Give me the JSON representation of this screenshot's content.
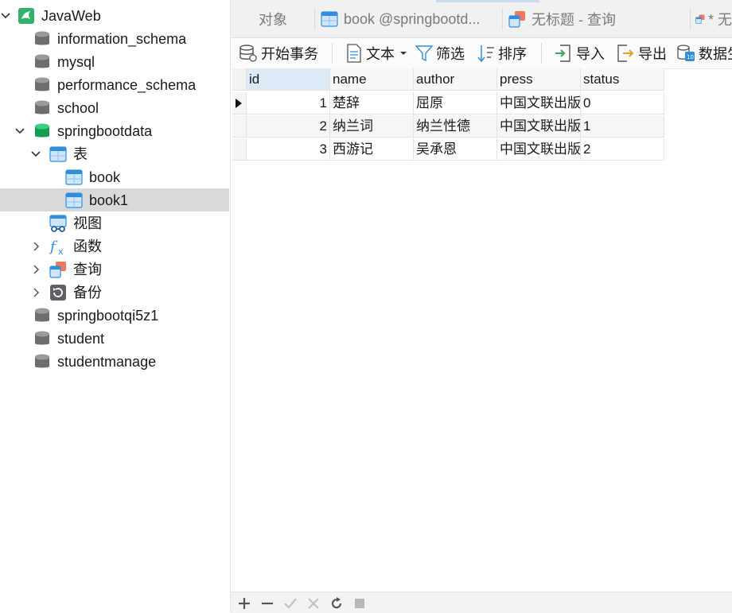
{
  "sidebar": {
    "connection": "JavaWeb",
    "databases_top": [
      "information_schema",
      "mysql",
      "performance_schema",
      "school"
    ],
    "open_db": "springbootdata",
    "tables_label": "表",
    "tables": [
      "book",
      "book1"
    ],
    "selected_table": "book1",
    "views_label": "视图",
    "functions_label": "函数",
    "queries_label": "查询",
    "backups_label": "备份",
    "databases_bottom": [
      "springbootqi5z1",
      "student",
      "studentmanage"
    ]
  },
  "tabs": {
    "objects": "对象",
    "book_tab": "book @springbootd...",
    "untitled_query": "无标题 - 查询",
    "partial_tab": "* 无"
  },
  "toolbar": {
    "begin_transaction": "开始事务",
    "text": "文本",
    "filter": "筛选",
    "sort": "排序",
    "import": "导入",
    "export": "导出",
    "data_generate": "数据生"
  },
  "grid": {
    "columns": [
      "id",
      "name",
      "author",
      "press",
      "status"
    ],
    "rows": [
      {
        "id": "1",
        "name": "楚辞",
        "author": "屈原",
        "press": "中国文联出版",
        "status": "0"
      },
      {
        "id": "2",
        "name": "纳兰词",
        "author": "纳兰性德",
        "press": "中国文联出版",
        "status": "1"
      },
      {
        "id": "3",
        "name": "西游记",
        "author": "吴承恩",
        "press": "中国文联出版",
        "status": "2"
      }
    ]
  },
  "colors": {
    "db_icon": "#6e6e6e",
    "active_db_icon": "#18a058",
    "table_icon": "#2f8ee0",
    "accent": "#1e7fd6"
  }
}
